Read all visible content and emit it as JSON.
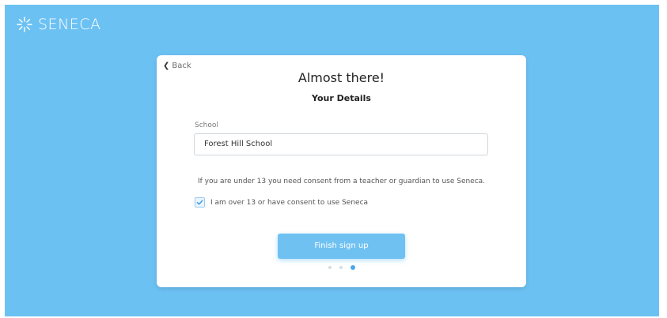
{
  "brand": {
    "name": "SENECA",
    "logo_icon": "seneca-starburst-icon"
  },
  "card": {
    "back_label": "Back",
    "title": "Almost there!",
    "subtitle": "Your Details",
    "school": {
      "label": "School",
      "value": "Forest Hill School"
    },
    "consent_notice": "If you are under 13 you need consent from a teacher or guardian to use Seneca.",
    "checkbox": {
      "label": "I am over 13 or have consent to use Seneca",
      "checked": true
    },
    "finish_button": "Finish sign up",
    "progress": {
      "steps": 3,
      "current_step": 3
    }
  },
  "colors": {
    "background": "#6cc1f3",
    "button": "#6fc1f2",
    "active_dot": "#4ba8e8"
  }
}
